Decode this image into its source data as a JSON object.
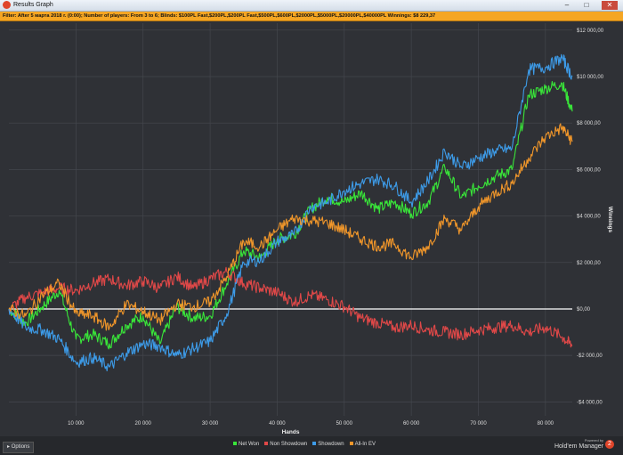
{
  "window": {
    "title": "Results Graph",
    "buttons": {
      "minimize": "–",
      "maximize": "□",
      "close": "✕"
    }
  },
  "filter": {
    "text": "Filter: After 5 марта 2018 г. (0:00); Number of players: From 3 to 6; Blinds: $100PL Fast,$200PL,$200PL Fast,$500PL,$600PL,$2000PL,$5000PL,$20000PL,$40000PL Winnings: $8 229,37"
  },
  "chart_data": {
    "type": "line",
    "xlabel": "Hands",
    "ylabel": "Winnings",
    "xlim": [
      0,
      84000
    ],
    "ylim": [
      -4600,
      12300
    ],
    "x_ticks": [
      "10 000",
      "20 000",
      "30 000",
      "40 000",
      "50 000",
      "60 000",
      "70 000",
      "80 000"
    ],
    "x_tick_values": [
      10000,
      20000,
      30000,
      40000,
      50000,
      60000,
      70000,
      80000
    ],
    "y_ticks": [
      "$12 000,00",
      "$10 000,00",
      "$8 000,00",
      "$6 000,00",
      "$4 000,00",
      "$2 000,00",
      "$0,00",
      "-$2 000,00",
      "-$4 000,00"
    ],
    "y_tick_values": [
      12000,
      10000,
      8000,
      6000,
      4000,
      2000,
      0,
      -2000,
      -4000
    ],
    "grid": true,
    "legend_position": "bottom",
    "x": [
      0,
      2500,
      5000,
      7500,
      10000,
      12500,
      15000,
      17500,
      20000,
      22500,
      25000,
      27500,
      30000,
      32500,
      35000,
      37500,
      40000,
      42500,
      45000,
      47500,
      50000,
      52500,
      55000,
      57500,
      60000,
      62500,
      65000,
      67500,
      70000,
      72500,
      75000,
      77500,
      80000,
      82500,
      84000
    ],
    "series": [
      {
        "name": "Net Won",
        "color": "#39e639",
        "values": [
          0,
          -600,
          100,
          800,
          -1300,
          -1100,
          -1500,
          -700,
          -300,
          -1500,
          100,
          -400,
          -300,
          1100,
          2500,
          2200,
          3000,
          3200,
          4300,
          4800,
          4600,
          5000,
          4300,
          4600,
          4100,
          4600,
          6100,
          4800,
          5300,
          5700,
          6000,
          9200,
          9500,
          9700,
          8500
        ]
      },
      {
        "name": "Non Showdown",
        "color": "#e04848",
        "values": [
          0,
          500,
          700,
          900,
          800,
          1100,
          1300,
          1000,
          1200,
          900,
          1400,
          900,
          1300,
          1600,
          1100,
          900,
          700,
          300,
          600,
          400,
          100,
          -400,
          -600,
          -800,
          -700,
          -900,
          -1000,
          -1100,
          -900,
          -800,
          -700,
          -1000,
          -800,
          -1200,
          -1600
        ]
      },
      {
        "name": "Showdown",
        "color": "#3d9be8",
        "values": [
          0,
          -800,
          -900,
          -1300,
          -2300,
          -2100,
          -2500,
          -1900,
          -1500,
          -1600,
          -2000,
          -1700,
          -1400,
          -200,
          2000,
          2100,
          2900,
          3200,
          4400,
          4600,
          5100,
          5400,
          5600,
          5300,
          4600,
          5500,
          6800,
          6100,
          6500,
          6800,
          6900,
          10300,
          10400,
          10800,
          10000
        ]
      },
      {
        "name": "All-In EV",
        "color": "#f0962a",
        "values": [
          0,
          -300,
          600,
          1100,
          -200,
          -300,
          -800,
          200,
          -100,
          -500,
          200,
          100,
          300,
          1400,
          2900,
          2700,
          3400,
          3900,
          3800,
          3700,
          3400,
          3000,
          2700,
          2800,
          2200,
          2700,
          3900,
          3400,
          4400,
          5000,
          5400,
          6500,
          7400,
          7800,
          7200
        ]
      }
    ]
  },
  "footer": {
    "options_label": "Options",
    "powered_by": "Powered by",
    "brand_name": "Hold'em Manager",
    "brand_mark": "2"
  }
}
